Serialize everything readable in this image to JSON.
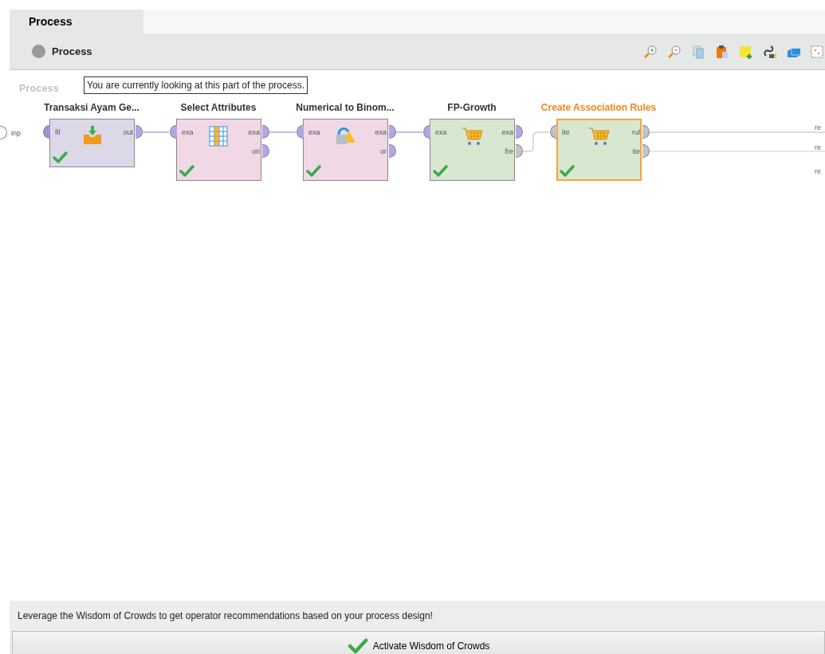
{
  "tabs": [
    {
      "label": "Process",
      "selected": true
    }
  ],
  "breadcrumb": {
    "label": "Process"
  },
  "tooltip": "You are currently looking at this part of the process.",
  "canvas": {
    "label": "Process",
    "input_port": "inp",
    "operators": [
      {
        "title": "Transaksi Ayam Ge...",
        "kind": "import",
        "color": "#dcd8e8",
        "selected": false,
        "ok": true,
        "inputs": [
          {
            "label": "fil",
            "color": "#a48fd8"
          }
        ],
        "outputs": [
          {
            "label": "out",
            "color": "#b3a6e6"
          }
        ]
      },
      {
        "title": "Select Attributes",
        "kind": "table",
        "color": "#f0d8e6",
        "selected": false,
        "ok": true,
        "inputs": [
          {
            "label": "exa",
            "color": "#b3a6e6"
          }
        ],
        "outputs": [
          {
            "label": "exa",
            "color": "#b3a6e6"
          },
          {
            "label": "ori",
            "color": "#b3a6e6"
          }
        ]
      },
      {
        "title": "Numerical to Binom...",
        "kind": "convert",
        "color": "#f0d8e6",
        "selected": false,
        "ok": true,
        "inputs": [
          {
            "label": "exa",
            "color": "#b3a6e6"
          }
        ],
        "outputs": [
          {
            "label": "exa",
            "color": "#b3a6e6"
          },
          {
            "label": "or",
            "color": "#b3a6e6"
          }
        ]
      },
      {
        "title": "FP-Growth",
        "kind": "cart",
        "color": "#d8e8d0",
        "selected": false,
        "ok": true,
        "inputs": [
          {
            "label": "exa",
            "color": "#b3a6e6"
          }
        ],
        "outputs": [
          {
            "label": "exa",
            "color": "#b3a6e6"
          },
          {
            "label": "fre",
            "color": "#c4c4c4"
          }
        ]
      },
      {
        "title": "Create Association Rules",
        "kind": "cart",
        "color": "#d8e8d0",
        "selected": true,
        "ok": true,
        "inputs": [
          {
            "label": "ite",
            "color": "#c4c4c4"
          }
        ],
        "outputs": [
          {
            "label": "rul",
            "color": "#c4c4c4"
          },
          {
            "label": "ite",
            "color": "#c4c4c4"
          }
        ]
      }
    ],
    "result_ports": [
      "re",
      "re",
      "re"
    ]
  },
  "wisdom": {
    "message": "Leverage the Wisdom of Crowds to get operator recommendations based on your process design!",
    "button": "Activate Wisdom of Crowds"
  }
}
